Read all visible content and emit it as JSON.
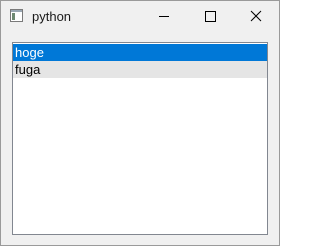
{
  "window": {
    "title": "python",
    "icon": "python-window-icon",
    "controls": [
      "minimize-icon",
      "maximize-icon",
      "close-icon"
    ]
  },
  "listbox": {
    "items": [
      {
        "label": "hoge",
        "state": "selected"
      },
      {
        "label": "fuga",
        "state": "hover"
      }
    ]
  },
  "colors": {
    "selection": "#0078d7",
    "hover": "#e5e5e5",
    "window_bg": "#f0f0f0",
    "list_border": "#828790"
  }
}
